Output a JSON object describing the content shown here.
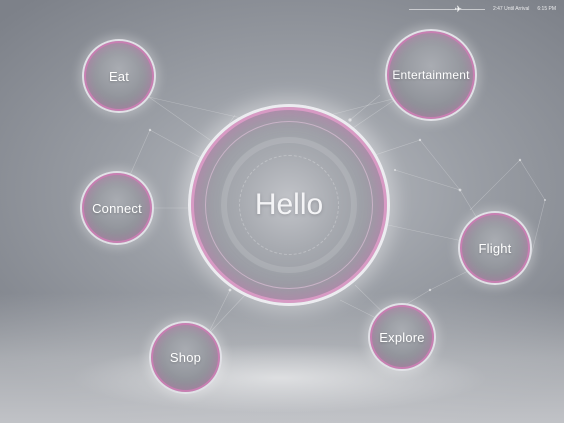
{
  "status_bar": {
    "flight_progress": 0.65,
    "arrival_text": "2:47 Until Arrival",
    "time": "6:15 PM",
    "icon": "airplane-icon"
  },
  "hub": {
    "label": "Hello"
  },
  "menu": {
    "eat": "Eat",
    "connect": "Connect",
    "shop": "Shop",
    "entertainment": "Entertainment",
    "flight": "Flight",
    "explore": "Explore"
  },
  "colors": {
    "accent": "#d673ba",
    "background": "#9a9ea5",
    "text": "#ffffff"
  }
}
